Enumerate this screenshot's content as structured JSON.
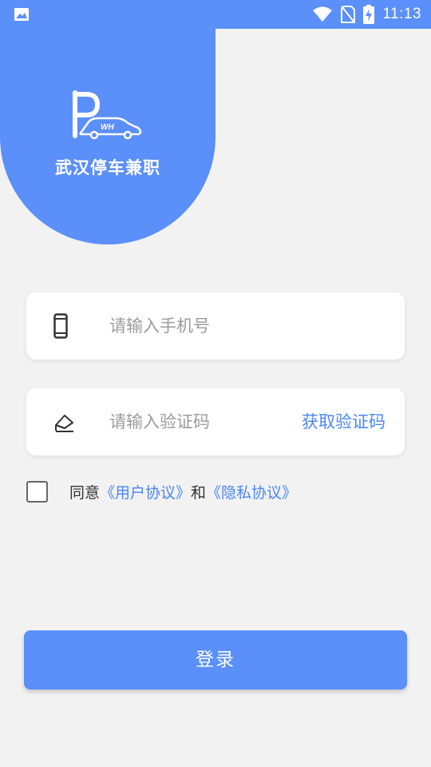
{
  "status_bar": {
    "time": "11:13",
    "icons": [
      "gallery-icon",
      "wifi-icon",
      "no-sim-icon",
      "battery-charging-icon"
    ]
  },
  "app": {
    "name": "武汉停车兼职",
    "logo_text": "WH"
  },
  "form": {
    "phone": {
      "placeholder": "请输入手机号",
      "value": "",
      "icon": "phone-icon"
    },
    "code": {
      "placeholder": "请输入验证码",
      "value": "",
      "icon": "envelope-icon",
      "get_code_label": "获取验证码"
    }
  },
  "agreement": {
    "prefix": "同意",
    "user_agreement": "《用户协议》",
    "conjunction": "和",
    "privacy_agreement": "《隐私协议》",
    "checked": false
  },
  "login": {
    "label": "登录"
  },
  "colors": {
    "primary": "#5b8ff9",
    "link": "#4a86f7",
    "background": "#f2f2f2"
  }
}
